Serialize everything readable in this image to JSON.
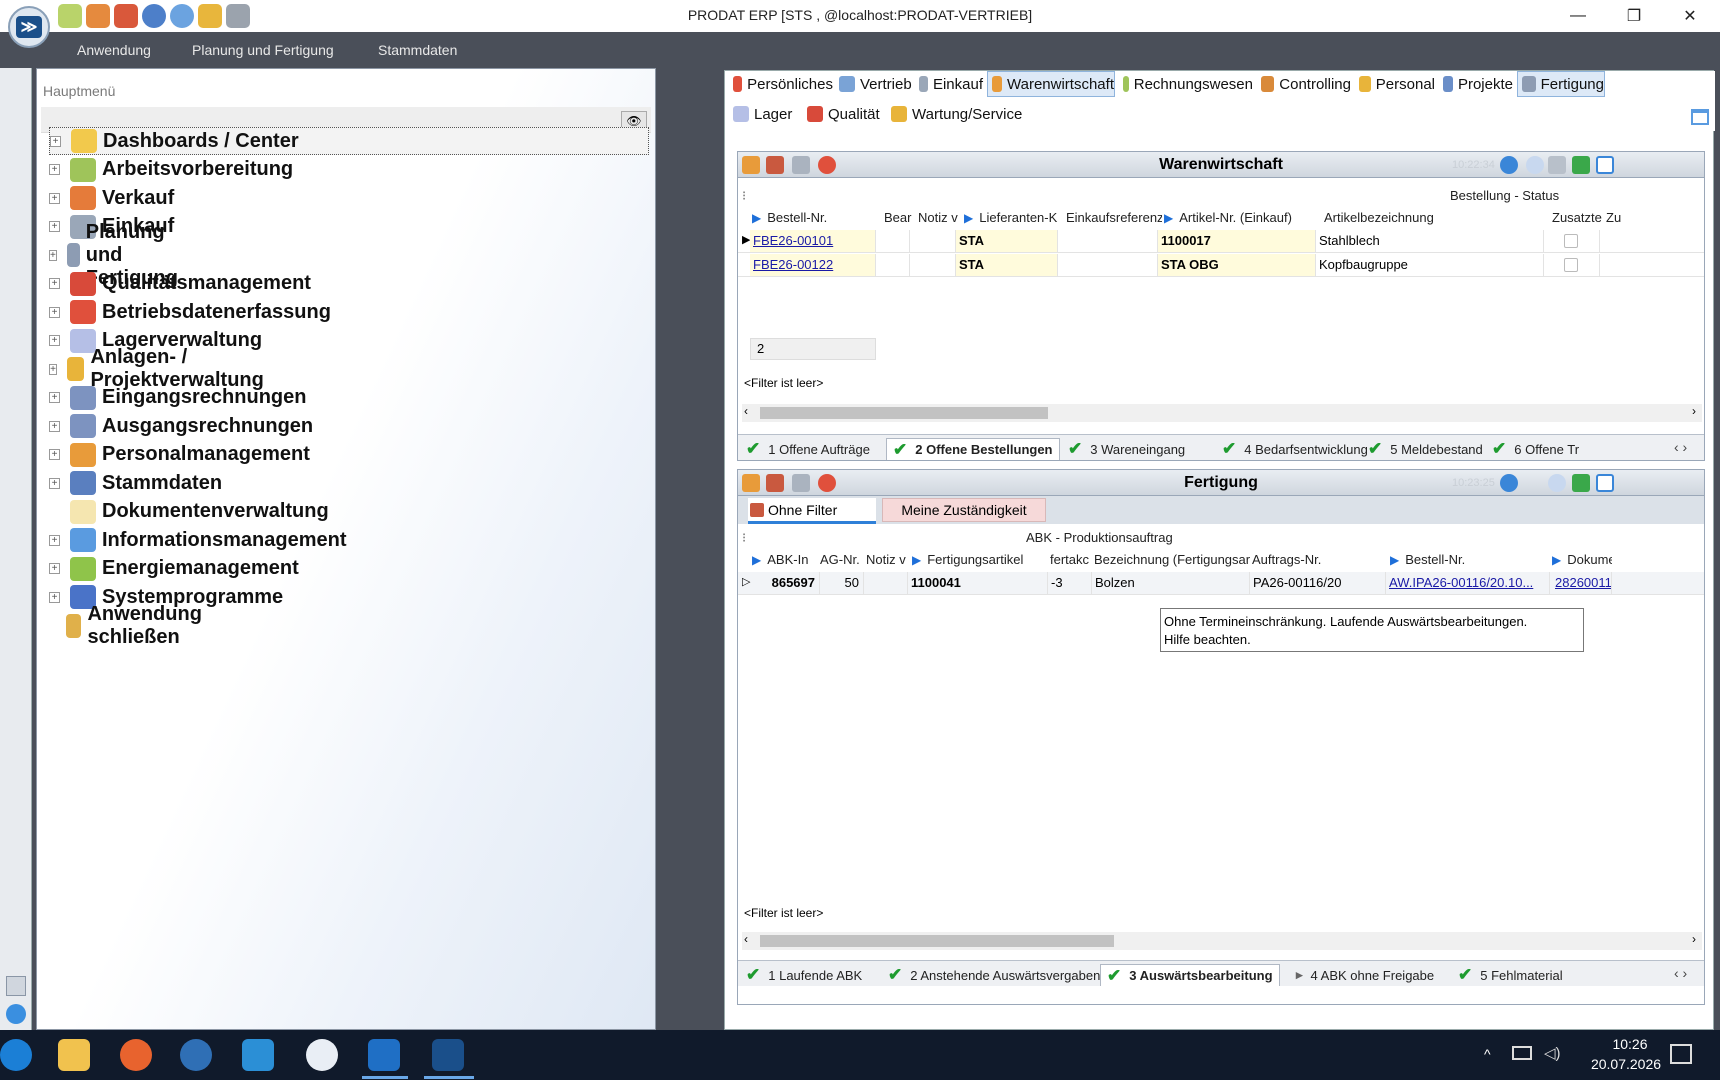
{
  "window": {
    "title": "PRODAT ERP   [STS ,  @localhost:PRODAT-VERTRIEB]",
    "logo_glyph": "≫",
    "minimize_icon": "—",
    "maximize_icon": "❐",
    "close_icon": "✕"
  },
  "menubar": [
    "Anwendung",
    "Planung und Fertigung",
    "Stammdaten"
  ],
  "mainmenu": {
    "label": "Hauptmenü",
    "items": [
      {
        "label": "Dashboards / Center",
        "color": "#f2c94c",
        "expand": true
      },
      {
        "label": "Arbeitsvorbereitung",
        "color": "#9fc45a",
        "expand": true
      },
      {
        "label": "Verkauf",
        "color": "#e57b3a",
        "expand": true
      },
      {
        "label": "Einkauf",
        "color": "#9aa7b8",
        "expand": true
      },
      {
        "label": "Planung und Fertigung",
        "color": "#8d9cb3",
        "expand": true
      },
      {
        "label": "Qualitätsmanagement",
        "color": "#d84a3a",
        "expand": true
      },
      {
        "label": "Betriebsdatenerfassung",
        "color": "#e0503c",
        "expand": true
      },
      {
        "label": "Lagerverwaltung",
        "color": "#b5bfe6",
        "expand": true
      },
      {
        "label": "Anlagen- / Projektverwaltung",
        "color": "#e8b43a",
        "expand": true
      },
      {
        "label": "Eingangsrechnungen",
        "color": "#7d93c0",
        "expand": true
      },
      {
        "label": "Ausgangsrechnungen",
        "color": "#7d93c0",
        "expand": true
      },
      {
        "label": "Personalmanagement",
        "color": "#e89b3a",
        "expand": true
      },
      {
        "label": "Stammdaten",
        "color": "#5a7fbf",
        "expand": true
      },
      {
        "label": "Dokumentenverwaltung",
        "color": "#f5e6b0",
        "expand": false
      },
      {
        "label": "Informationsmanagement",
        "color": "#5a9be0",
        "expand": true
      },
      {
        "label": "Energiemanagement",
        "color": "#8fc44a",
        "expand": true
      },
      {
        "label": "Systemprogramme",
        "color": "#4a73c8",
        "expand": true
      },
      {
        "label": "Anwendung schließen",
        "color": "#e0b04a",
        "expand": false
      }
    ]
  },
  "topnav": {
    "row1": [
      "Persönliches",
      "Vertrieb",
      "Einkauf",
      "Warenwirtschaft",
      "Rechnungswesen",
      "Controlling",
      "Personal",
      "Projekte",
      "Fertigung"
    ],
    "row2": [
      "Lager",
      "Qualität",
      "Wartung/Service"
    ],
    "active": [
      "Warenwirtschaft",
      "Fertigung"
    ]
  },
  "warenwirtschaft": {
    "title": "Warenwirtschaft",
    "time": "10:22:34",
    "group_header": "Bestellung - Status",
    "columns": [
      "Bestell-Nr.",
      "Bear",
      "Notiz v",
      "Lieferanten-K",
      "Einkaufsreferenz",
      "Artikel-Nr. (Einkauf)",
      "Artikelbezeichnung",
      "Zusatzte",
      "Zu"
    ],
    "rows": [
      {
        "bestell": "FBE26-00101",
        "lieferant": "STA",
        "artikel": "1100017",
        "bezeichnung": "Stahlblech"
      },
      {
        "bestell": "FBE26-00122",
        "lieferant": "STA",
        "artikel": "STA OBG",
        "bezeichnung": "Kopfbaugruppe"
      }
    ],
    "count": "2",
    "filter": "<Filter ist leer>",
    "tabs": [
      "1 Offene Aufträge",
      "2 Offene Bestellungen",
      "3 Wareneingang",
      "4 Bedarfsentwicklung",
      "5 Meldebestand",
      "6 Offene Tr"
    ],
    "active_tab": "2 Offene Bestellungen"
  },
  "fertigung": {
    "title": "Fertigung",
    "time": "10:23:25",
    "filter_tabs": [
      "Ohne Filter",
      "Meine Zuständigkeit"
    ],
    "group_header": "ABK - Produktionsauftrag",
    "columns": [
      "ABK-In",
      "AG-Nr.",
      "Notiz v",
      "Fertigungsartikel",
      "fertakc",
      "Bezeichnung (Fertigungsart",
      "Auftrags-Nr.",
      "Bestell-Nr.",
      "Dokume"
    ],
    "rows": [
      {
        "abk": "865697",
        "ag": "50",
        "artikel": "1100041",
        "fert": "-3",
        "bezeichnung": "Bolzen",
        "auftrag": "PA26-00116/20",
        "bestell": "AW.IPA26-00116/20.10...",
        "dok": "28260011"
      }
    ],
    "tooltip_line1": "Ohne Termineinschränkung. Laufende Auswärtsbearbeitungen.",
    "tooltip_line2": "Hilfe beachten.",
    "filter": "<Filter ist leer>",
    "tabs": [
      "1 Laufende ABK",
      "2 Anstehende Auswärtsvergaben",
      "3 Auswärtsbearbeitung",
      "4 ABK ohne Freigabe",
      "5 Fehlmaterial"
    ],
    "active_tab": "3 Auswärtsbearbeitung"
  },
  "taskbar": {
    "time": "10:26",
    "date": "20.07.2026"
  }
}
